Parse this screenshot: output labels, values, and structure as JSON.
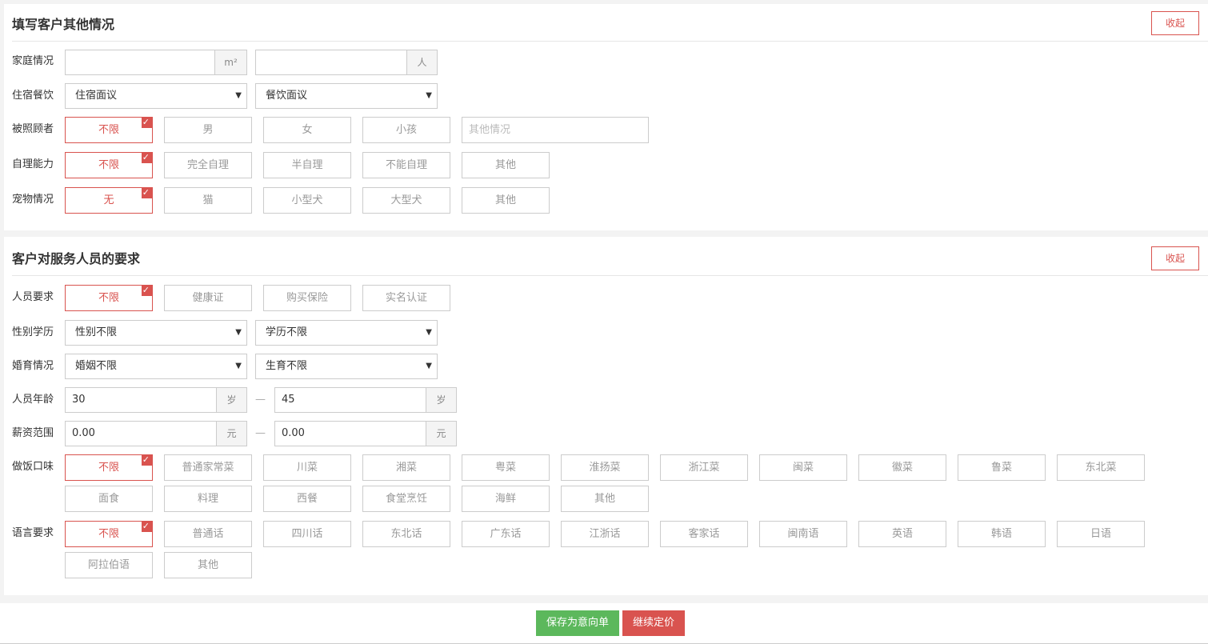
{
  "section1": {
    "title": "填写客户其他情况",
    "collapse_label": "收起",
    "family": {
      "label": "家庭情况",
      "area_value": "",
      "area_unit": "m²",
      "people_value": "",
      "people_unit": "人"
    },
    "lodging": {
      "label": "住宿餐饮",
      "lodging_selected": "住宿面议",
      "meal_selected": "餐饮面议"
    },
    "cared": {
      "label": "被照顾者",
      "options": [
        "不限",
        "男",
        "女",
        "小孩"
      ],
      "selected": "不限",
      "other_placeholder": "其他情况"
    },
    "selfcare": {
      "label": "自理能力",
      "options": [
        "不限",
        "完全自理",
        "半自理",
        "不能自理",
        "其他"
      ],
      "selected": "不限"
    },
    "pets": {
      "label": "宠物情况",
      "options": [
        "无",
        "猫",
        "小型犬",
        "大型犬",
        "其他"
      ],
      "selected": "无"
    }
  },
  "section2": {
    "title": "客户对服务人员的要求",
    "collapse_label": "收起",
    "personnel": {
      "label": "人员要求",
      "options": [
        "不限",
        "健康证",
        "购买保险",
        "实名认证"
      ],
      "selected": "不限"
    },
    "gender_edu": {
      "label": "性别学历",
      "gender_selected": "性别不限",
      "edu_selected": "学历不限"
    },
    "marriage": {
      "label": "婚育情况",
      "marriage_selected": "婚姻不限",
      "birth_selected": "生育不限"
    },
    "age": {
      "label": "人员年龄",
      "min": "30",
      "max": "45",
      "unit": "岁",
      "separator": "—"
    },
    "salary": {
      "label": "薪资范围",
      "min": "0.00",
      "max": "0.00",
      "unit": "元",
      "separator": "—"
    },
    "cuisine": {
      "label": "做饭口味",
      "options_row1": [
        "不限",
        "普通家常菜",
        "川菜",
        "湘菜",
        "粤菜",
        "淮扬菜",
        "浙江菜",
        "闽菜",
        "徽菜",
        "鲁菜",
        "东北菜"
      ],
      "options_row2": [
        "面食",
        "料理",
        "西餐",
        "食堂烹饪",
        "海鲜",
        "其他"
      ],
      "selected": "不限"
    },
    "language": {
      "label": "语言要求",
      "options_row1": [
        "不限",
        "普通话",
        "四川话",
        "东北话",
        "广东话",
        "江浙话",
        "客家话",
        "闽南语",
        "英语",
        "韩语",
        "日语"
      ],
      "options_row2": [
        "阿拉伯语",
        "其他"
      ],
      "selected": "不限"
    }
  },
  "footer": {
    "save_label": "保存为意向单",
    "continue_label": "继续定价"
  },
  "colors": {
    "accent_red": "#d9534f",
    "accent_green": "#5cb85c"
  },
  "icons": {
    "check": "✓",
    "dropdown": "▼"
  }
}
